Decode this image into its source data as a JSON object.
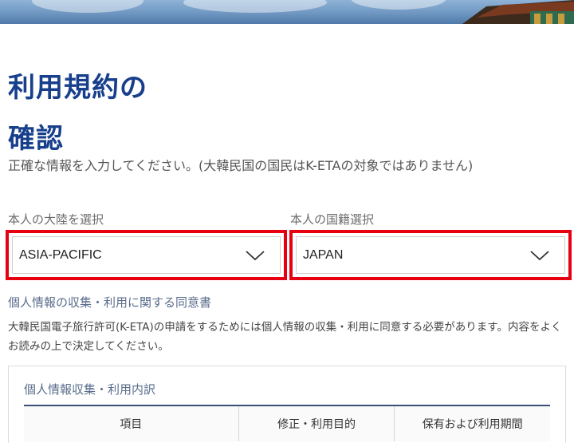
{
  "header": {
    "title_line1": "利用規約の",
    "title_line2": "確認"
  },
  "intro_text": "正確な情報を入力してください。(大韓民国の国民はK-ETAの対象ではありません)",
  "continent": {
    "label": "本人の大陸を選択",
    "value": "ASIA-PACIFIC"
  },
  "nationality": {
    "label": "本人の国籍選択",
    "value": "JAPAN"
  },
  "consent": {
    "heading": "個人情報の収集・利用に関する同意書",
    "text": "大韓民国電子旅行許可(K-ETA)の申請をするためには個人情報の収集・利用に同意する必要があります。内容をよくお読みの上で決定してください。"
  },
  "details": {
    "title": "個人情報収集・利用内訳",
    "columns": [
      "項目",
      "修正・利用目的",
      "保有および利用期間"
    ]
  },
  "colors": {
    "title": "#173f8c",
    "highlight_border": "#e60012"
  }
}
